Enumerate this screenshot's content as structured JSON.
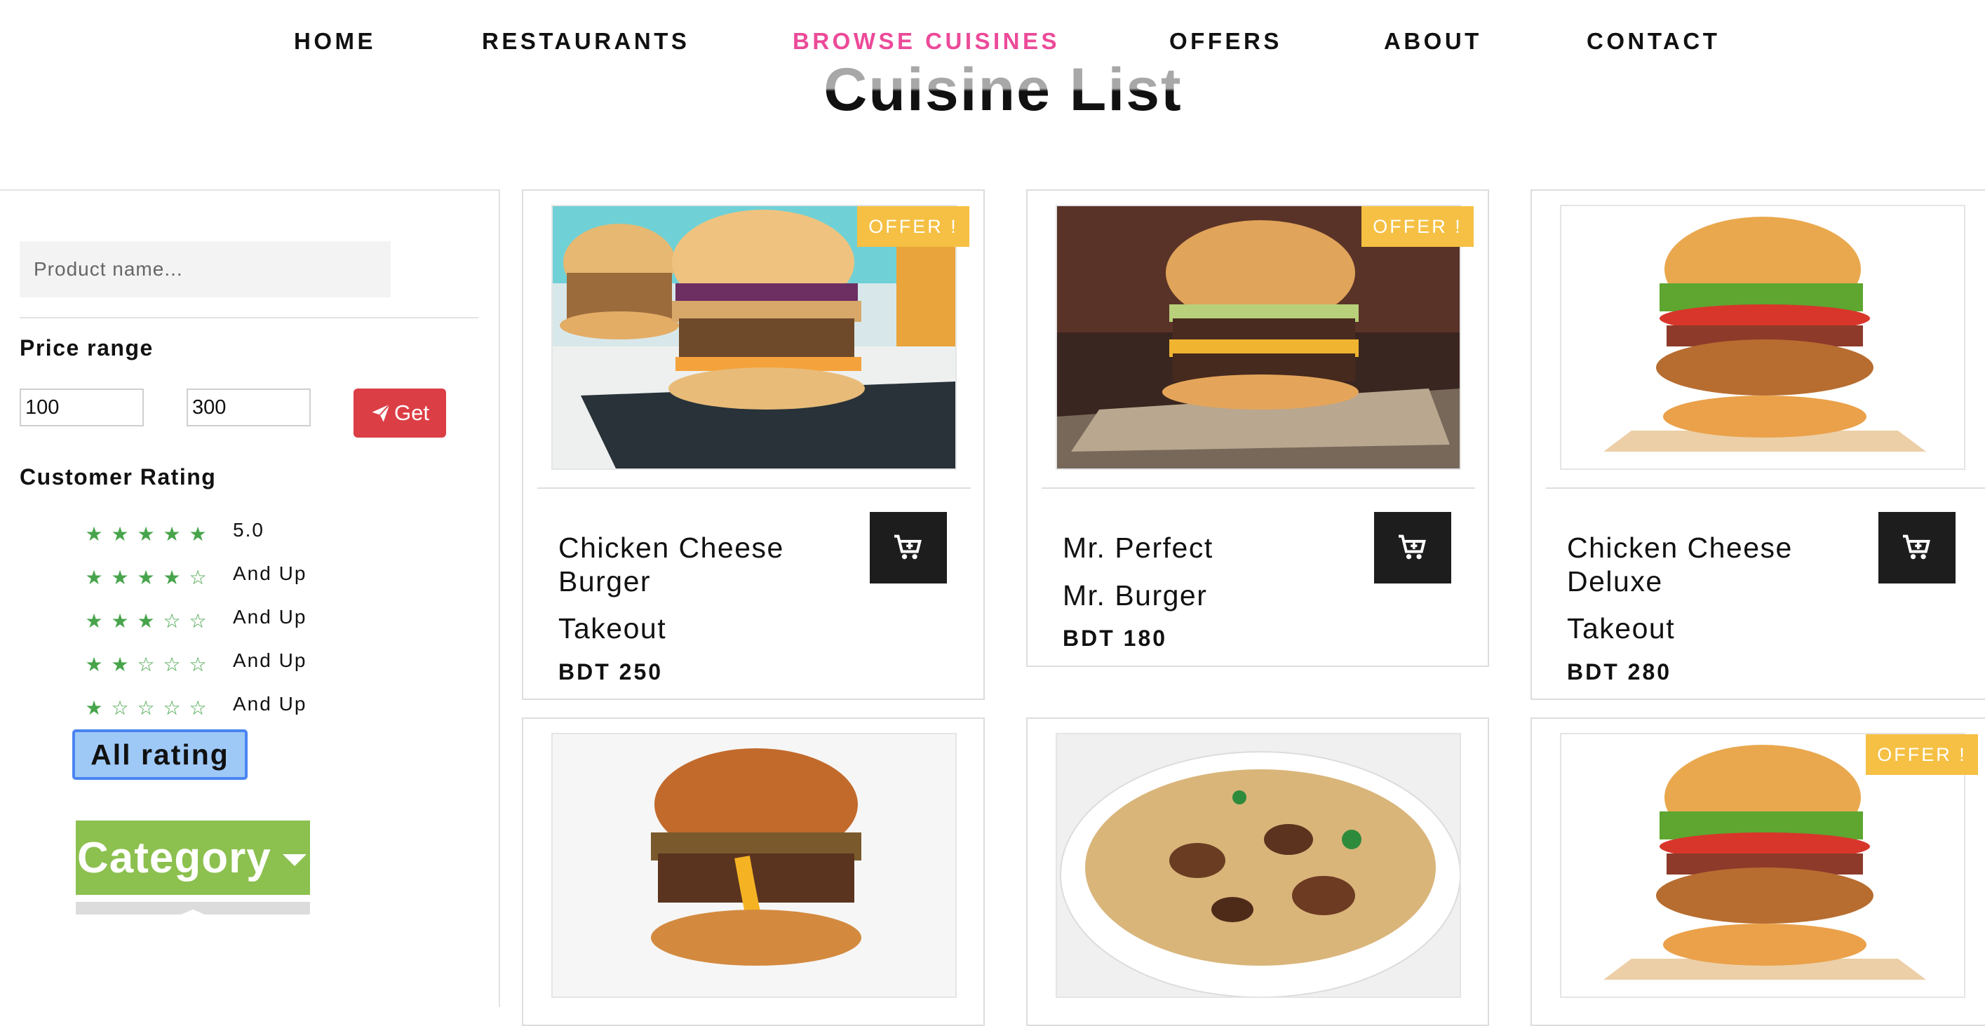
{
  "nav": {
    "items": [
      "HOME",
      "RESTAURANTS",
      "BROWSE CUISINES",
      "OFFERS",
      "ABOUT",
      "CONTACT"
    ],
    "active": "BROWSE CUISINES"
  },
  "page_title": "Cuisine List",
  "sidebar": {
    "search_placeholder": "Product name...",
    "price_range_label": "Price range",
    "price_min": "100",
    "price_max": "300",
    "get_label": "Get",
    "rating_label": "Customer Rating",
    "ratings": [
      {
        "stars": 5,
        "text": "5.0"
      },
      {
        "stars": 4,
        "text": "And Up"
      },
      {
        "stars": 3,
        "text": "And Up"
      },
      {
        "stars": 2,
        "text": "And Up"
      },
      {
        "stars": 1,
        "text": "And Up"
      }
    ],
    "all_rating_label": "All rating",
    "category_label": "Category"
  },
  "offer_badge": "OFFER !",
  "products": [
    {
      "name": "Chicken Cheese Burger",
      "name_line1": "Chicken Cheese",
      "name_line2": "Burger",
      "tag": "Takeout",
      "price": "BDT 250",
      "offer": true,
      "image": "burger-veggie-slaw"
    },
    {
      "name": "Mr. Perfect",
      "name_line1": "Mr. Perfect",
      "tag": "Mr. Burger",
      "price": "BDT 180",
      "offer": true,
      "image": "double-cheeseburger"
    },
    {
      "name": "Chicken Cheese Deluxe",
      "name_line1": "Chicken Cheese",
      "name_line2": "Deluxe",
      "tag": "Takeout",
      "price": "BDT 280",
      "offer": false,
      "image": "crispy-chicken-bacon-burger"
    },
    {
      "name": "",
      "image": "egg-burger",
      "offer": false
    },
    {
      "name": "",
      "image": "biryani",
      "offer": false
    },
    {
      "name": "",
      "image": "crispy-chicken-bacon-burger",
      "offer": true
    }
  ],
  "colors": {
    "nav_active": "#ec4a99",
    "get_button": "#dc3e45",
    "star": "#47a44b",
    "offer_badge": "#f5c043",
    "category": "#8cc04f",
    "all_rating_bg": "#9ec9f7",
    "cart_button": "#1d1d1d"
  }
}
